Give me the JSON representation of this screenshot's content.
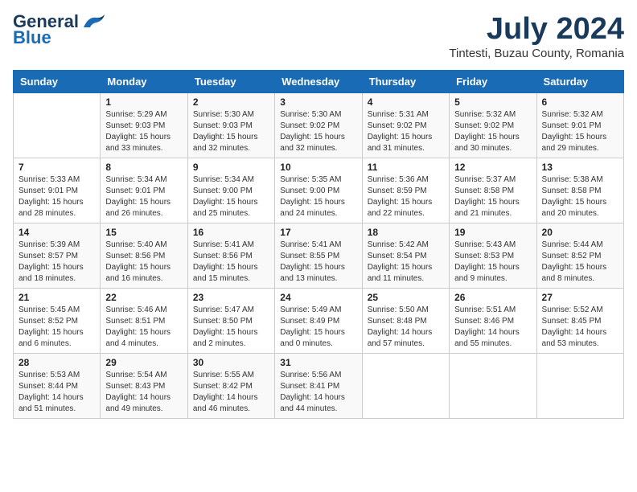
{
  "header": {
    "logo_line1": "General",
    "logo_line2": "Blue",
    "month_year": "July 2024",
    "location": "Tintesti, Buzau County, Romania"
  },
  "days_of_week": [
    "Sunday",
    "Monday",
    "Tuesday",
    "Wednesday",
    "Thursday",
    "Friday",
    "Saturday"
  ],
  "weeks": [
    [
      {
        "day": "",
        "info": ""
      },
      {
        "day": "1",
        "info": "Sunrise: 5:29 AM\nSunset: 9:03 PM\nDaylight: 15 hours\nand 33 minutes."
      },
      {
        "day": "2",
        "info": "Sunrise: 5:30 AM\nSunset: 9:03 PM\nDaylight: 15 hours\nand 32 minutes."
      },
      {
        "day": "3",
        "info": "Sunrise: 5:30 AM\nSunset: 9:02 PM\nDaylight: 15 hours\nand 32 minutes."
      },
      {
        "day": "4",
        "info": "Sunrise: 5:31 AM\nSunset: 9:02 PM\nDaylight: 15 hours\nand 31 minutes."
      },
      {
        "day": "5",
        "info": "Sunrise: 5:32 AM\nSunset: 9:02 PM\nDaylight: 15 hours\nand 30 minutes."
      },
      {
        "day": "6",
        "info": "Sunrise: 5:32 AM\nSunset: 9:01 PM\nDaylight: 15 hours\nand 29 minutes."
      }
    ],
    [
      {
        "day": "7",
        "info": "Sunrise: 5:33 AM\nSunset: 9:01 PM\nDaylight: 15 hours\nand 28 minutes."
      },
      {
        "day": "8",
        "info": "Sunrise: 5:34 AM\nSunset: 9:01 PM\nDaylight: 15 hours\nand 26 minutes."
      },
      {
        "day": "9",
        "info": "Sunrise: 5:34 AM\nSunset: 9:00 PM\nDaylight: 15 hours\nand 25 minutes."
      },
      {
        "day": "10",
        "info": "Sunrise: 5:35 AM\nSunset: 9:00 PM\nDaylight: 15 hours\nand 24 minutes."
      },
      {
        "day": "11",
        "info": "Sunrise: 5:36 AM\nSunset: 8:59 PM\nDaylight: 15 hours\nand 22 minutes."
      },
      {
        "day": "12",
        "info": "Sunrise: 5:37 AM\nSunset: 8:58 PM\nDaylight: 15 hours\nand 21 minutes."
      },
      {
        "day": "13",
        "info": "Sunrise: 5:38 AM\nSunset: 8:58 PM\nDaylight: 15 hours\nand 20 minutes."
      }
    ],
    [
      {
        "day": "14",
        "info": "Sunrise: 5:39 AM\nSunset: 8:57 PM\nDaylight: 15 hours\nand 18 minutes."
      },
      {
        "day": "15",
        "info": "Sunrise: 5:40 AM\nSunset: 8:56 PM\nDaylight: 15 hours\nand 16 minutes."
      },
      {
        "day": "16",
        "info": "Sunrise: 5:41 AM\nSunset: 8:56 PM\nDaylight: 15 hours\nand 15 minutes."
      },
      {
        "day": "17",
        "info": "Sunrise: 5:41 AM\nSunset: 8:55 PM\nDaylight: 15 hours\nand 13 minutes."
      },
      {
        "day": "18",
        "info": "Sunrise: 5:42 AM\nSunset: 8:54 PM\nDaylight: 15 hours\nand 11 minutes."
      },
      {
        "day": "19",
        "info": "Sunrise: 5:43 AM\nSunset: 8:53 PM\nDaylight: 15 hours\nand 9 minutes."
      },
      {
        "day": "20",
        "info": "Sunrise: 5:44 AM\nSunset: 8:52 PM\nDaylight: 15 hours\nand 8 minutes."
      }
    ],
    [
      {
        "day": "21",
        "info": "Sunrise: 5:45 AM\nSunset: 8:52 PM\nDaylight: 15 hours\nand 6 minutes."
      },
      {
        "day": "22",
        "info": "Sunrise: 5:46 AM\nSunset: 8:51 PM\nDaylight: 15 hours\nand 4 minutes."
      },
      {
        "day": "23",
        "info": "Sunrise: 5:47 AM\nSunset: 8:50 PM\nDaylight: 15 hours\nand 2 minutes."
      },
      {
        "day": "24",
        "info": "Sunrise: 5:49 AM\nSunset: 8:49 PM\nDaylight: 15 hours\nand 0 minutes."
      },
      {
        "day": "25",
        "info": "Sunrise: 5:50 AM\nSunset: 8:48 PM\nDaylight: 14 hours\nand 57 minutes."
      },
      {
        "day": "26",
        "info": "Sunrise: 5:51 AM\nSunset: 8:46 PM\nDaylight: 14 hours\nand 55 minutes."
      },
      {
        "day": "27",
        "info": "Sunrise: 5:52 AM\nSunset: 8:45 PM\nDaylight: 14 hours\nand 53 minutes."
      }
    ],
    [
      {
        "day": "28",
        "info": "Sunrise: 5:53 AM\nSunset: 8:44 PM\nDaylight: 14 hours\nand 51 minutes."
      },
      {
        "day": "29",
        "info": "Sunrise: 5:54 AM\nSunset: 8:43 PM\nDaylight: 14 hours\nand 49 minutes."
      },
      {
        "day": "30",
        "info": "Sunrise: 5:55 AM\nSunset: 8:42 PM\nDaylight: 14 hours\nand 46 minutes."
      },
      {
        "day": "31",
        "info": "Sunrise: 5:56 AM\nSunset: 8:41 PM\nDaylight: 14 hours\nand 44 minutes."
      },
      {
        "day": "",
        "info": ""
      },
      {
        "day": "",
        "info": ""
      },
      {
        "day": "",
        "info": ""
      }
    ]
  ]
}
